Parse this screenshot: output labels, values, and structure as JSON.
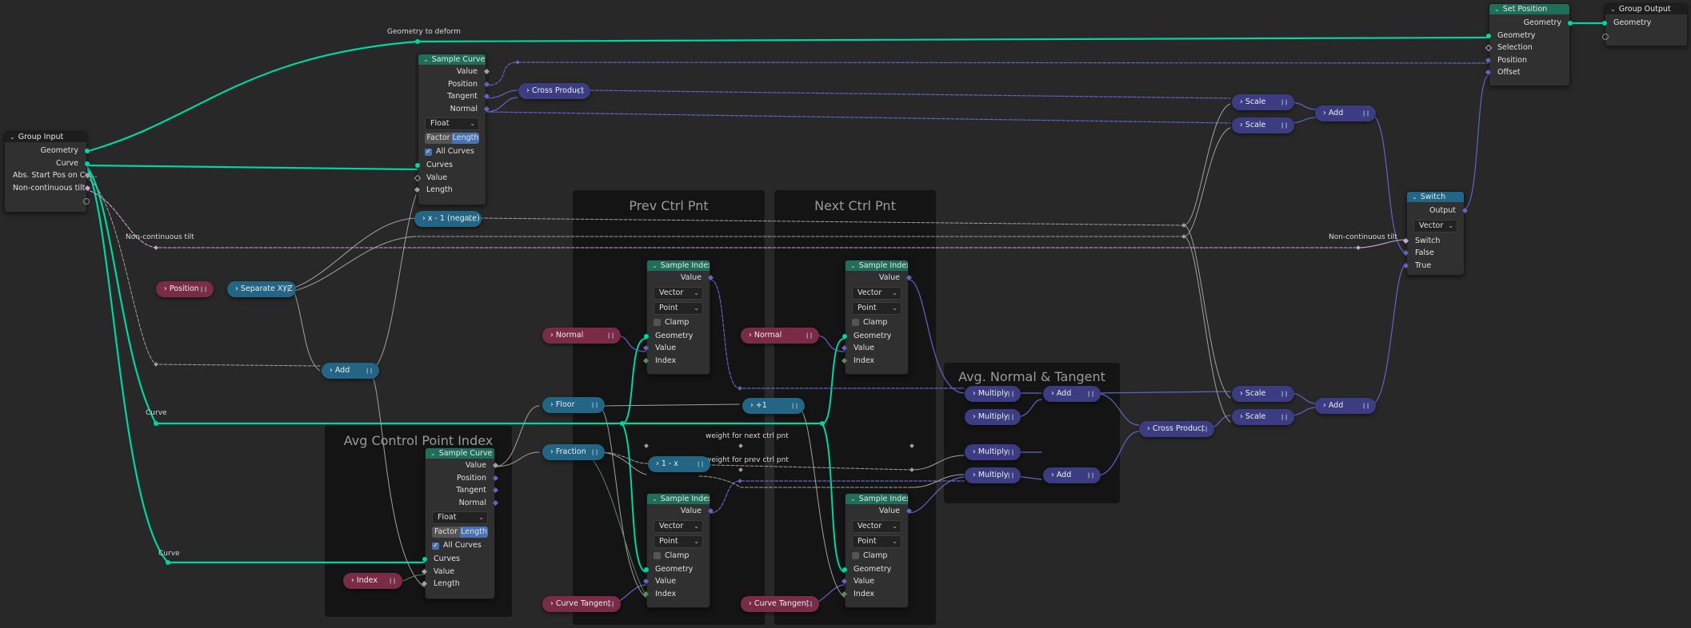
{
  "frames": {
    "prev_ctrl_pnt": "Prev Ctrl Pnt",
    "next_ctrl_pnt": "Next Ctrl Pnt",
    "avg_control_point_index": "Avg Control Point Index",
    "avg_normal_tangent": "Avg. Normal & Tangent"
  },
  "reroute_labels": {
    "geometry_to_deform": "Geometry to deform",
    "non_continuous_tilt_left": "Non-continuous tilt",
    "non_continuous_tilt_right": "Non-continuous tilt",
    "curve_upper": "Curve",
    "curve_lower": "Curve",
    "weight_next": "weight for next ctrl pnt",
    "weight_prev": "weight for prev ctrl pnt"
  },
  "group_input": {
    "title": "Group Input",
    "outputs": [
      "Geometry",
      "Curve",
      "Abs. Start Pos on Cu...",
      "Non-continuous tilt"
    ]
  },
  "sample_curve_top": {
    "title": "Sample Curve",
    "outputs": [
      "Value",
      "Position",
      "Tangent",
      "Normal"
    ],
    "data_type": "Float",
    "mode_options": [
      "Factor",
      "Length"
    ],
    "mode_selected": "Length",
    "all_curves_label": "All Curves",
    "all_curves_checked": true,
    "inputs": [
      "Curves",
      "Value",
      "Length"
    ]
  },
  "sample_curve_bottom": {
    "title": "Sample Curve",
    "outputs": [
      "Value",
      "Position",
      "Tangent",
      "Normal"
    ],
    "data_type": "Float",
    "mode_options": [
      "Factor",
      "Length"
    ],
    "mode_selected": "Length",
    "all_curves_label": "All Curves",
    "all_curves_checked": true,
    "inputs": [
      "Curves",
      "Value",
      "Length"
    ]
  },
  "sample_index": {
    "title": "Sample Index",
    "output": "Value",
    "data_type": "Vector",
    "domain": "Point",
    "clamp_label": "Clamp",
    "clamp_checked": false,
    "inputs": [
      "Geometry",
      "Value",
      "Index"
    ]
  },
  "set_position": {
    "title": "Set Position",
    "output": "Geometry",
    "inputs": [
      "Geometry",
      "Selection",
      "Position",
      "Offset"
    ]
  },
  "group_output": {
    "title": "Group Output",
    "inputs": [
      "Geometry"
    ]
  },
  "switch": {
    "title": "Switch",
    "output": "Output",
    "data_type": "Vector",
    "inputs": [
      "Switch",
      "False",
      "True"
    ]
  },
  "collapsed_nodes": {
    "cross_product_top": "Cross Product",
    "cross_product_bottom": "Cross Product",
    "position": "Position",
    "separate_xyz": "Separate XYZ",
    "negate": "x - 1 (negate)",
    "add_left": "Add",
    "floor": "Floor",
    "fraction": "Fraction",
    "one_minus_x": "1 - x",
    "plus_one": "+1",
    "normal_prev": "Normal",
    "normal_next": "Normal",
    "curve_tangent_prev": "Curve Tangent",
    "curve_tangent_next": "Curve Tangent",
    "index": "Index",
    "multiply_1": "Multiply",
    "multiply_2": "Multiply",
    "multiply_3": "Multiply",
    "multiply_4": "Multiply",
    "add_avg_top": "Add",
    "add_avg_bottom": "Add",
    "scale_1": "Scale",
    "scale_2": "Scale",
    "scale_3": "Scale",
    "scale_4": "Scale",
    "add_top_right": "Add",
    "add_bottom_right": "Add"
  },
  "colors": {
    "geometry_socket": "#00d6a3",
    "vector_socket": "#6363c7",
    "float_socket": "#a1a1a1",
    "bool_socket": "#cca6d6",
    "int_socket": "#598c5c",
    "input_node": "#7a2b45",
    "converter_node": "#236584",
    "vector_node": "#3c3c83",
    "geometry_node_header": "#1e6e58",
    "background": "#282828",
    "frame": "#141414"
  }
}
